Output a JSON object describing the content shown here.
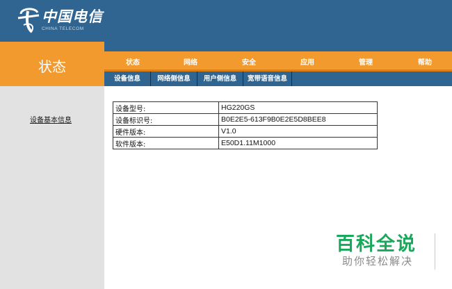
{
  "brand": {
    "name_cn": "中国电信",
    "name_en": "CHINA TELECOM"
  },
  "sidebar": {
    "title": "状态",
    "items": [
      {
        "label": "设备基本信息"
      }
    ]
  },
  "main_nav": [
    {
      "label": "状态"
    },
    {
      "label": "网络"
    },
    {
      "label": "安全"
    },
    {
      "label": "应用"
    },
    {
      "label": "管理"
    },
    {
      "label": "帮助"
    }
  ],
  "sub_nav": [
    {
      "label": "设备信息"
    },
    {
      "label": "网络侧信息"
    },
    {
      "label": "用户侧信息"
    },
    {
      "label": "宽带语音信息"
    }
  ],
  "device_info": {
    "rows": [
      {
        "key": "设备型号:",
        "value": "HG220GS"
      },
      {
        "key": "设备标识号:",
        "value": "B0E2E5-613F9B0E2E5D8BEE8"
      },
      {
        "key": "硬件版本:",
        "value": "V1.0"
      },
      {
        "key": "软件版本:",
        "value": "E50D1.11M1000"
      }
    ]
  },
  "watermark": {
    "title": "百科全说",
    "subtitle": "助你轻松解决"
  },
  "colors": {
    "header_blue": "#2f6590",
    "accent_orange": "#f39a2e",
    "sidebar_gray": "#e2e2e2",
    "watermark_green": "#19a85b"
  }
}
